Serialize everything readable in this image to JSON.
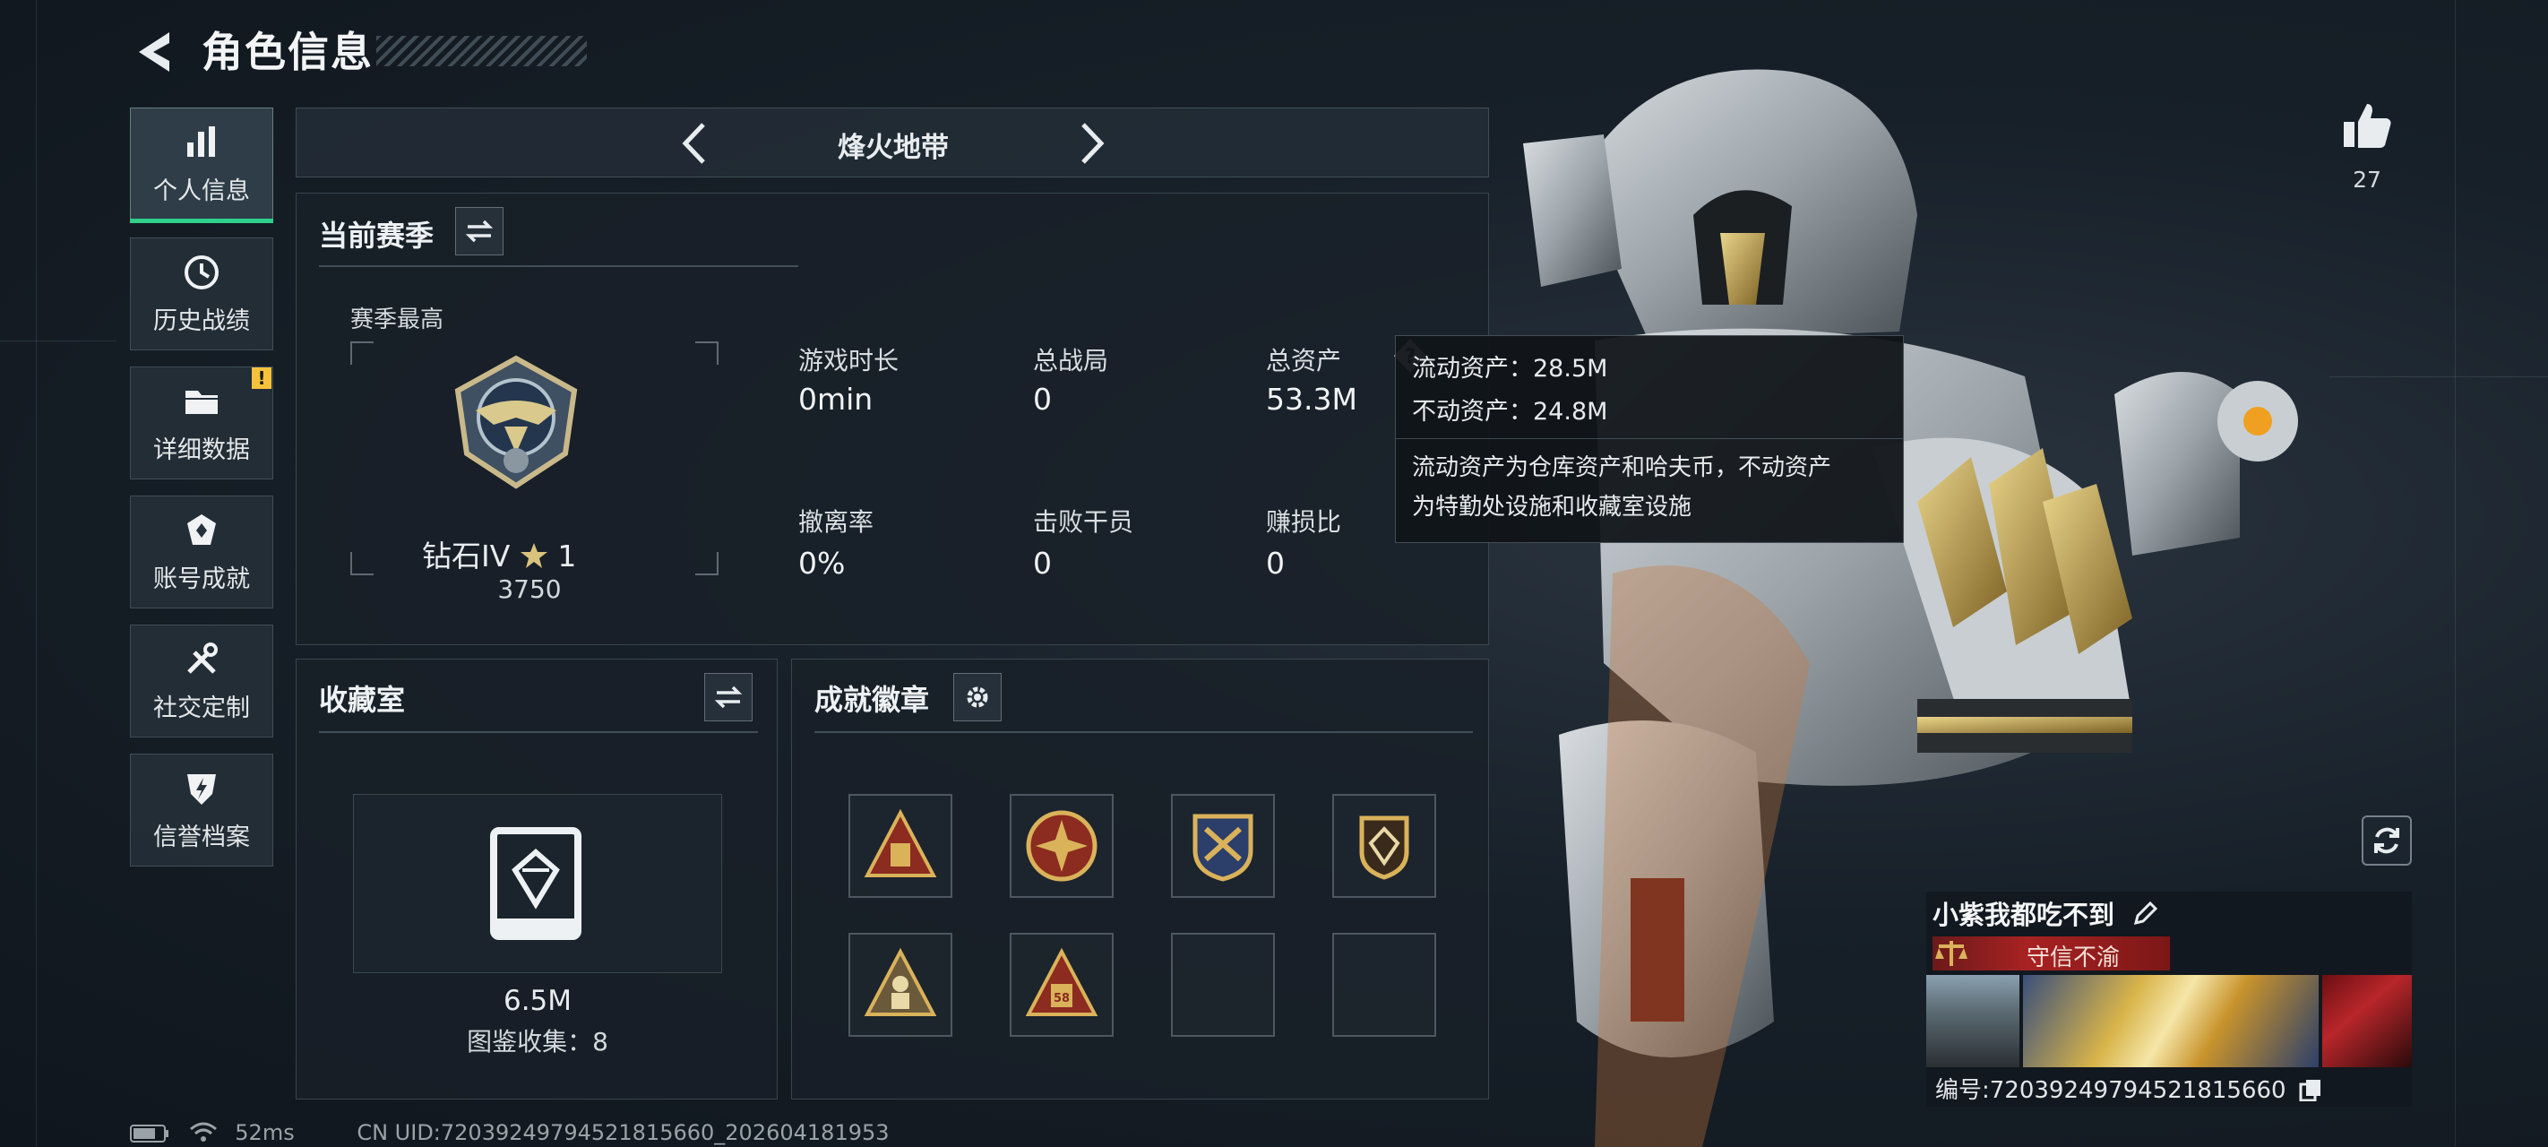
{
  "header": {
    "title": "角色信息"
  },
  "sidebar": {
    "items": [
      {
        "label": "个人信息",
        "icon": "bar-chart-icon",
        "active": true
      },
      {
        "label": "历史战绩",
        "icon": "clock-icon"
      },
      {
        "label": "详细数据",
        "icon": "folder-icon",
        "badge": "!"
      },
      {
        "label": "账号成就",
        "icon": "achievement-icon"
      },
      {
        "label": "社交定制",
        "icon": "tools-icon"
      },
      {
        "label": "信誉档案",
        "icon": "shield-icon"
      }
    ]
  },
  "mode_selector": {
    "title": "烽火地带"
  },
  "season": {
    "title": "当前赛季",
    "highest_label": "赛季最高",
    "rank_name": "钻石IV",
    "rank_stars": "1",
    "rank_score": "3750",
    "stats": [
      {
        "label": "游戏时长",
        "value": "0min"
      },
      {
        "label": "总战局",
        "value": "0"
      },
      {
        "label": "总资产",
        "value": "53.3M"
      },
      {
        "label": "撤离率",
        "value": "0%"
      },
      {
        "label": "击败干员",
        "value": "0"
      },
      {
        "label": "赚损比",
        "value": "0"
      }
    ]
  },
  "tooltip": {
    "line1": "流动资产：28.5M",
    "line2": "不动资产：24.8M",
    "desc1": "流动资产为仓库资产和哈夫币，不动资产",
    "desc2": "为特勤处设施和收藏室设施"
  },
  "collection": {
    "title": "收藏室",
    "value": "6.5M",
    "count_label": "图鉴收集：8"
  },
  "achievements": {
    "title": "成就徽章"
  },
  "profile": {
    "like_count": "27",
    "player_name": "小紫我都吃不到",
    "motto": "守信不渝",
    "uid_line": "编号:7203924979452181566​0"
  },
  "status_bar": {
    "ping": "52ms",
    "uid": "CN UID:7203924979452181566​0_202604181953"
  },
  "colors": {
    "accent": "#2fd08a",
    "notify": "#f5c33b",
    "motto": "#a82222"
  }
}
